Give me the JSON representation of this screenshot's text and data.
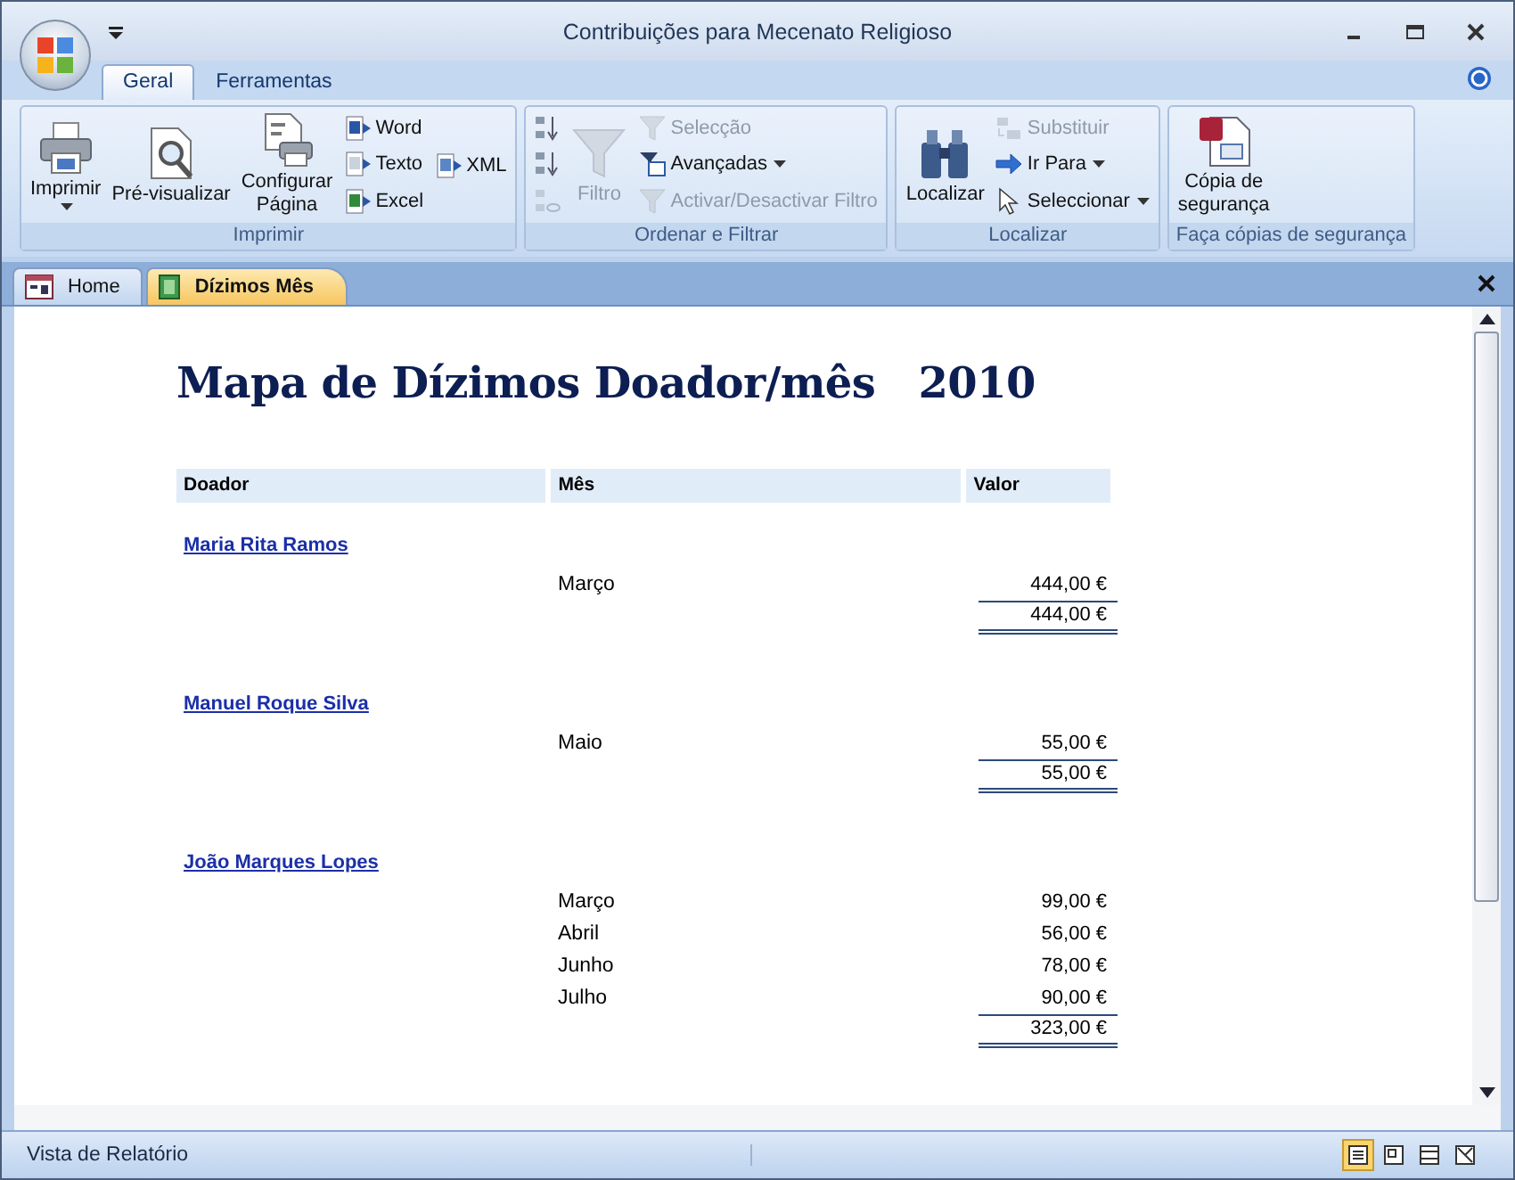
{
  "window": {
    "title": "Contribuições para Mecenato Religioso"
  },
  "ribbon": {
    "tabs": [
      {
        "label": "Geral",
        "selected": true
      },
      {
        "label": "Ferramentas",
        "selected": false
      }
    ],
    "groups": [
      {
        "label": "Imprimir",
        "columns": [
          [
            {
              "kind": "large",
              "label": "Imprimir",
              "disabled": false,
              "dropdown": true
            }
          ],
          [
            {
              "kind": "large",
              "label": "Pré-visualizar",
              "disabled": false,
              "dropdown": false
            }
          ],
          [
            {
              "kind": "large",
              "label": "Configurar\nPágina",
              "disabled": false,
              "dropdown": false
            }
          ],
          [
            {
              "kind": "small",
              "label": "Word",
              "disabled": false,
              "dropdown": false
            },
            {
              "kind": "small",
              "label": "Texto",
              "disabled": false,
              "dropdown": false
            },
            {
              "kind": "small",
              "label": "Excel",
              "disabled": false,
              "dropdown": false
            }
          ],
          [
            {
              "kind": "small",
              "label": "XML",
              "disabled": false,
              "dropdown": false
            }
          ]
        ]
      },
      {
        "label": "Ordenar e Filtrar",
        "columns": [
          [
            {
              "kind": "icon",
              "disabled": false
            },
            {
              "kind": "icon",
              "disabled": false
            },
            {
              "kind": "icon",
              "disabled": true
            }
          ],
          [
            {
              "kind": "large",
              "label": "Filtro",
              "disabled": true,
              "dropdown": false
            }
          ],
          [
            {
              "kind": "small",
              "label": "Selecção",
              "disabled": true,
              "dropdown": false
            },
            {
              "kind": "small",
              "label": "Avançadas",
              "disabled": false,
              "dropdown": true
            },
            {
              "kind": "small",
              "label": "Activar/Desactivar Filtro",
              "disabled": true,
              "dropdown": false
            }
          ]
        ]
      },
      {
        "label": "Localizar",
        "columns": [
          [
            {
              "kind": "large",
              "label": "Localizar",
              "disabled": false,
              "dropdown": false
            }
          ],
          [
            {
              "kind": "small",
              "label": "Substituir",
              "disabled": true,
              "dropdown": false
            },
            {
              "kind": "small",
              "label": "Ir Para",
              "disabled": false,
              "dropdown": true
            },
            {
              "kind": "small",
              "label": "Seleccionar",
              "disabled": false,
              "dropdown": true
            }
          ]
        ]
      },
      {
        "label": "Faça cópias de segurança",
        "columns": [
          [
            {
              "kind": "large",
              "label": "Cópia de\nsegurança",
              "disabled": false,
              "dropdown": false
            }
          ]
        ]
      }
    ]
  },
  "document_tabs": [
    {
      "label": "Home",
      "selected": false
    },
    {
      "label": "Dízimos Mês",
      "selected": true
    }
  ],
  "report": {
    "title": "Mapa de Dízimos Doador/mês   2010",
    "columns": [
      "Doador",
      "Mês",
      "Valor"
    ],
    "donors": [
      {
        "name": "Maria Rita Ramos",
        "entries": [
          {
            "month": "Março",
            "value": "444,00 €"
          }
        ],
        "total": "444,00 €"
      },
      {
        "name": "Manuel Roque Silva",
        "entries": [
          {
            "month": "Maio",
            "value": "55,00 €"
          }
        ],
        "total": "55,00 €"
      },
      {
        "name": "João Marques Lopes",
        "entries": [
          {
            "month": "Março",
            "value": "99,00 €"
          },
          {
            "month": "Abril",
            "value": "56,00 €"
          },
          {
            "month": "Junho",
            "value": "78,00 €"
          },
          {
            "month": "Julho",
            "value": "90,00 €"
          }
        ],
        "total": "323,00 €"
      }
    ]
  },
  "status_bar": {
    "text": "Vista de Relatório",
    "view_buttons": [
      {
        "selected": true
      },
      {
        "selected": false
      },
      {
        "selected": false
      },
      {
        "selected": false
      }
    ]
  }
}
